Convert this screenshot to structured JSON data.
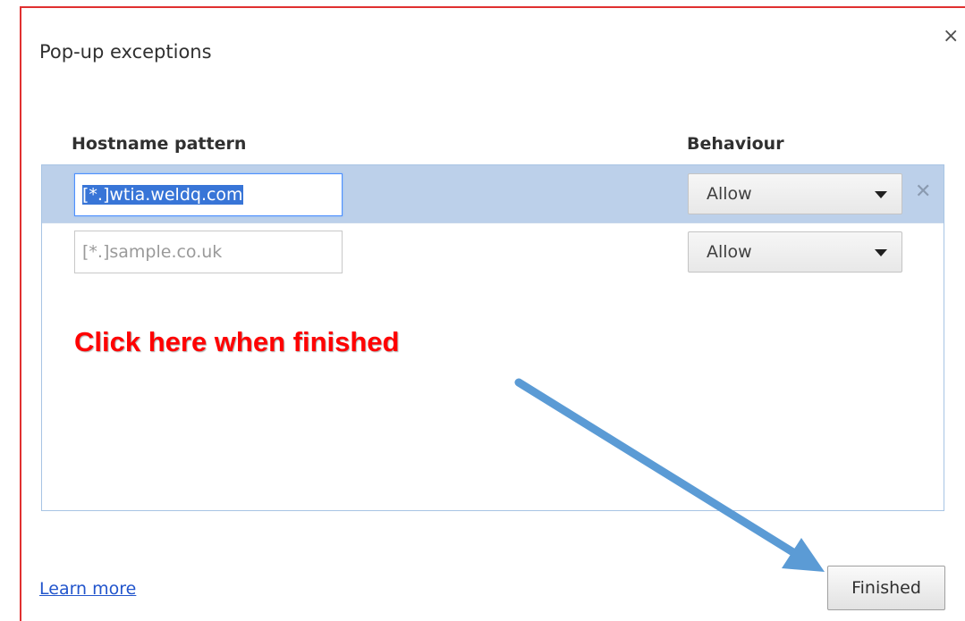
{
  "dialog": {
    "title": "Pop-up exceptions",
    "close_glyph": "×",
    "close_icon": "close-icon"
  },
  "columns": {
    "hostname": "Hostname pattern",
    "behaviour": "Behaviour"
  },
  "rows": [
    {
      "hostname_value": "[*.]wtia.weldq.com",
      "behaviour": "Allow",
      "selected": true,
      "delete_glyph": "✕"
    },
    {
      "hostname_placeholder": "[*.]sample.co.uk",
      "behaviour": "Allow",
      "selected": false
    }
  ],
  "annotation": {
    "text": "Click here when finished",
    "color": "#ff0000",
    "arrow_color": "#5b9bd5"
  },
  "footer": {
    "learn_more": "Learn more",
    "finished_button": "Finished"
  },
  "colors": {
    "selected_row": "#bcd0ea",
    "frame": "#e03030",
    "link": "#2255cc"
  }
}
